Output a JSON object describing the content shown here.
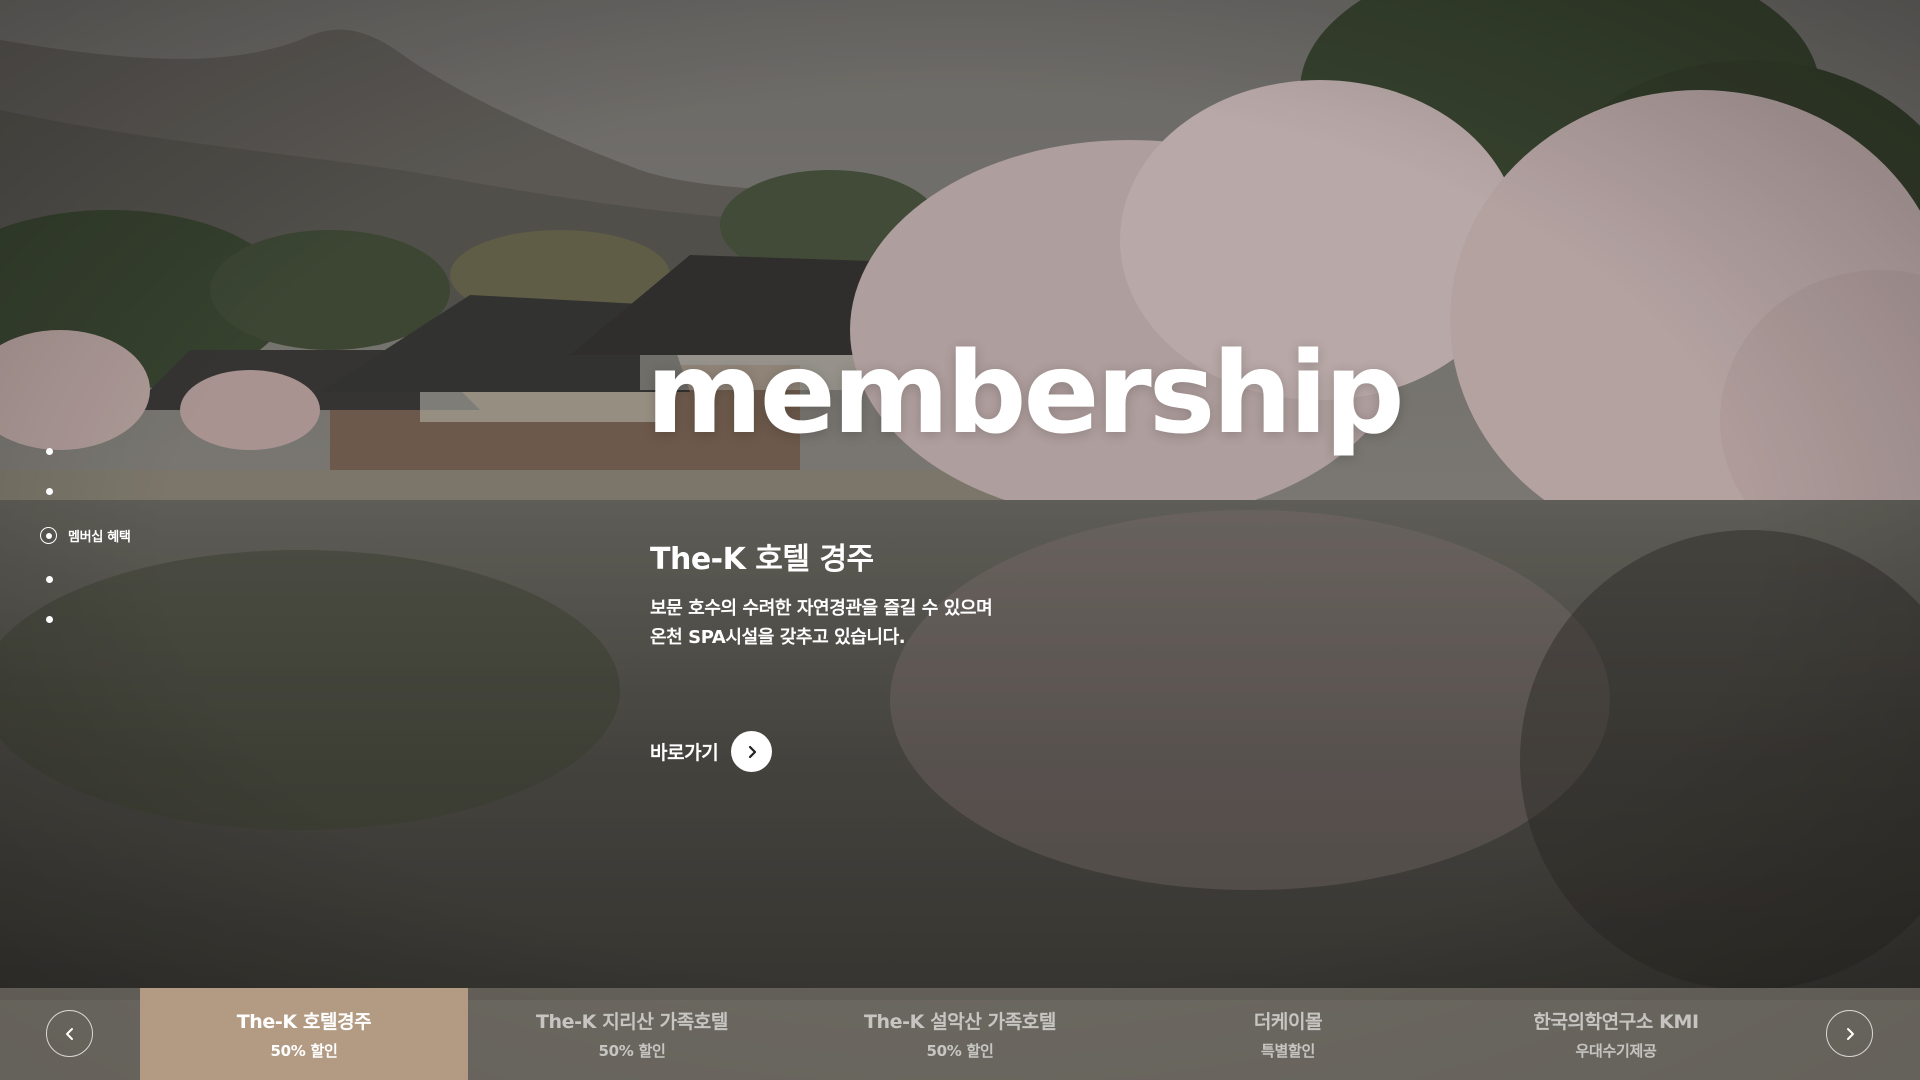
{
  "hero": {
    "title": "membership",
    "hotel_name": "The-K 호텔 경주",
    "description": [
      "보문 호수의 수려한 자연경관을 즐길 수 있으며",
      "온천 SPA시설을 갖추고 있습니다."
    ],
    "cta_label": "바로가기"
  },
  "side_nav": {
    "active_label": "멤버십 혜택"
  },
  "tabs": [
    {
      "title": "The-K 호텔경주",
      "sub": "50% 할인"
    },
    {
      "title": "The-K 지리산 가족호텔",
      "sub": "50% 할인"
    },
    {
      "title": "The-K 설악산 가족호텔",
      "sub": "50% 할인"
    },
    {
      "title": "더케이몰",
      "sub": "특별할인"
    },
    {
      "title": "한국의학연구소 KMI",
      "sub": "우대수기제공"
    }
  ],
  "colors": {
    "active_tab": "#b39b83",
    "bottom_bar": "#757068",
    "sky": "#7a7772",
    "water": "#4e4c46",
    "blossom": "#dbc8c8"
  }
}
